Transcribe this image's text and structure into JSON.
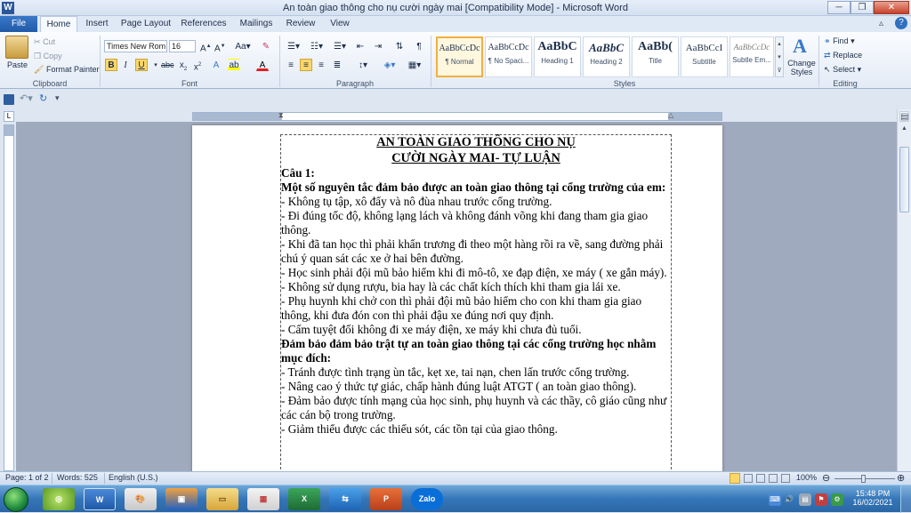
{
  "window": {
    "title": "An toàn giao thông cho nụ cười ngày mai [Compatibility Mode] - Microsoft Word",
    "minimize": "─",
    "restore": "❐",
    "close": "✕"
  },
  "tabs": {
    "file": "File",
    "items": [
      "Home",
      "Insert",
      "Page Layout",
      "References",
      "Mailings",
      "Review",
      "View"
    ]
  },
  "ribbon": {
    "clipboard": {
      "paste": "Paste",
      "cut": "Cut",
      "copy": "Copy",
      "format_painter": "Format Painter",
      "label": "Clipboard"
    },
    "font": {
      "family": "Times New Rom",
      "size": "16",
      "label": "Font"
    },
    "paragraph": {
      "label": "Paragraph"
    },
    "styles": {
      "label": "Styles",
      "items": [
        {
          "preview": "AaBbCcDc",
          "name": "¶ Normal"
        },
        {
          "preview": "AaBbCcDc",
          "name": "¶ No Spaci..."
        },
        {
          "preview": "AaBbC",
          "name": "Heading 1"
        },
        {
          "preview": "AaBbC",
          "name": "Heading 2"
        },
        {
          "preview": "AaBb(",
          "name": "Title"
        },
        {
          "preview": "AaBbCcI",
          "name": "Subtitle"
        },
        {
          "preview": "AaBbCcDc",
          "name": "Subtle Em..."
        }
      ],
      "change_styles": "Change Styles"
    },
    "editing": {
      "find": "Find",
      "replace": "Replace",
      "select": "Select",
      "label": "Editing"
    }
  },
  "document": {
    "title_line1": "AN TOÀN GIAO THÔNG CHO NỤ",
    "title_line2": "CƯỜI NGÀY MAI- TỰ LUẬN",
    "lines": [
      {
        "text": "Câu 1:",
        "bold": true
      },
      {
        "text": "Một số nguyên tắc đảm bảo được an toàn giao thông tại cổng trường của em:",
        "bold": true
      },
      {
        "text": "- Không tụ tập, xô đẩy và nô đùa nhau trước cổng trường.",
        "bold": false
      },
      {
        "text": "- Đi đúng tốc độ, không lạng lách và không  đánh võng khi đang tham gia giao thông.",
        "bold": false
      },
      {
        "text": "- Khi đã tan học thì phải khẩn trương đi theo một hàng rồi ra về, sang đường phải chú ý quan sát các xe ở hai bên đường.",
        "bold": false
      },
      {
        "text": "- Học sinh phải đội mũ bảo hiểm khi đi mô-tô, xe đạp điện, xe máy ( xe gắn máy).",
        "bold": false
      },
      {
        "text": "- Không sử dụng rượu, bia hay là các chất kích thích khi tham gia lái xe.",
        "bold": false
      },
      {
        "text": "- Phụ huynh khi chở con thì phải đội mũ bảo hiểm cho con khi tham gia giao thông, khi đưa đón con thì phải đậu xe đúng nơi quy định.",
        "bold": false
      },
      {
        "text": "- Cấm tuyệt đối không đi xe máy điện, xe máy khi chưa đủ tuổi.",
        "bold": false
      },
      {
        "text": "Đảm bảo đảm bảo trật tự an toàn giao thông tại các cổng trường học nhằm mục đích:",
        "bold": true
      },
      {
        "text": "- Tránh được tình trạng ùn tắc, kẹt xe, tai nạn, chen lấn trước cổng trường.",
        "bold": false
      },
      {
        "text": "- Nâng cao ý thức tự giác, chấp hành đúng luật ATGT ( an toàn giao thông).",
        "bold": false
      },
      {
        "text": "- Đảm bảo được tính mạng của học sinh, phụ huynh và các thầy, cô giáo cũng như các cán bộ trong trường.",
        "bold": false
      },
      {
        "text": "- Giảm thiểu được các thiếu sót, các tồn tại của giao thông.",
        "bold": false
      }
    ]
  },
  "status": {
    "page": "Page: 1 of 2",
    "words": "Words: 525",
    "language": "English (U.S.)",
    "zoom": "100%"
  },
  "taskbar": {
    "apps": [
      "chrome-like",
      "word",
      "paint",
      "app",
      "explorer",
      "app2",
      "excel",
      "teamviewer",
      "powerpoint",
      "zalo"
    ],
    "zalo_label": "Zalo",
    "time": "15:48 PM",
    "date": "16/02/2021"
  },
  "colors": {
    "ribbon_bg": "#e3ebf6",
    "file_tab": "#1f5aa8",
    "taskbar": "#3576b8",
    "highlight": "#fbd76a"
  }
}
